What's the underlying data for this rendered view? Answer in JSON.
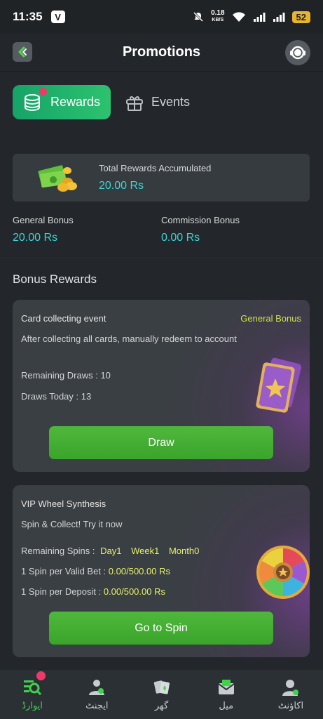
{
  "status_bar": {
    "time": "11:35",
    "app_badge": "V",
    "net_speed_value": "0.18",
    "net_speed_unit": "KB/S",
    "battery": "52"
  },
  "header": {
    "title": "Promotions"
  },
  "tabs": [
    {
      "label": "Rewards",
      "active": true
    },
    {
      "label": "Events",
      "active": false
    }
  ],
  "total": {
    "label": "Total Rewards Accumulated",
    "value": "20.00 Rs"
  },
  "general_bonus": {
    "label": "General Bonus",
    "value": "20.00 Rs"
  },
  "commission_bonus": {
    "label": "Commission Bonus",
    "value": "0.00 Rs"
  },
  "section_title": "Bonus Rewards",
  "card_event": {
    "title": "Card collecting event",
    "tag": "General Bonus",
    "description": "After collecting all cards, manually redeem to account",
    "remaining_label": "Remaining Draws :",
    "remaining_value": "10",
    "today_label": "Draws Today :",
    "today_value": "13",
    "button": "Draw"
  },
  "wheel": {
    "title": "VIP Wheel Synthesis",
    "subtitle": "Spin & Collect! Try it now",
    "remaining_label": "Remaining Spins :",
    "day": "Day1",
    "week": "Week1",
    "month": "Month0",
    "bet_label": "1 Spin per Valid Bet :",
    "bet_value": "0.00/500.00 Rs",
    "deposit_label": "1 Spin per Deposit :",
    "deposit_value": "0.00/500.00 Rs",
    "button": "Go to Spin"
  },
  "nav": [
    {
      "label": "ایوارڈ",
      "icon": "rewards-search-icon",
      "active": true
    },
    {
      "label": "ایجنٹ",
      "icon": "agent-icon",
      "active": false
    },
    {
      "label": "گھر",
      "icon": "home-cards-icon",
      "active": false
    },
    {
      "label": "میل",
      "icon": "mail-icon",
      "active": false
    },
    {
      "label": "اکاؤنٹ",
      "icon": "account-icon",
      "active": false
    }
  ],
  "colors": {
    "accent_green": "#2dc26f",
    "value_cyan": "#37d6d6",
    "highlight_yellow": "#e6f06a",
    "badge_red": "#f0386b"
  }
}
